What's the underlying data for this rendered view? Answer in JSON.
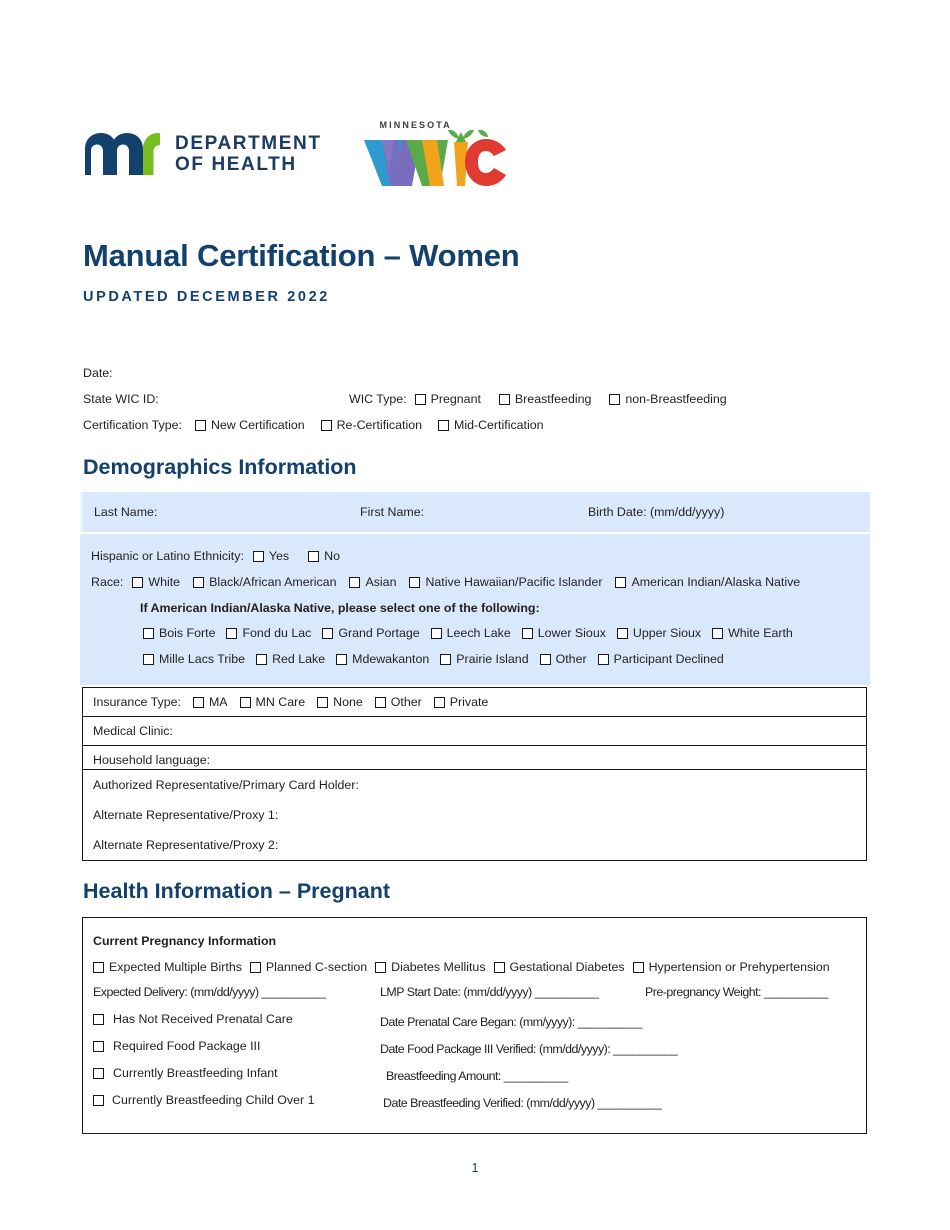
{
  "logos": {
    "mdh": {
      "mark": "mn-logo-icon",
      "line1": "DEPARTMENT",
      "line2": "OF HEALTH"
    },
    "wic": {
      "supertitle": "MINNESOTA",
      "wordmark": "WIC"
    }
  },
  "title": "Manual Certification – Women",
  "subtitle": "UPDATED DECEMBER 2022",
  "topform": {
    "date_label": "Date:",
    "state_wic_id_label": "State WIC ID:",
    "wic_type_label": "WIC Type:",
    "wic_type_options": [
      "Pregnant",
      "Breastfeeding",
      "non-Breastfeeding"
    ],
    "cert_type_label": "Certification Type:",
    "cert_type_options": [
      "New Certification",
      "Re-Certification",
      "Mid-Certification"
    ]
  },
  "demographics": {
    "heading": "Demographics Information",
    "name_row": {
      "last_name": "Last Name:",
      "first_name": "First Name:",
      "birth_date": "Birth Date: (mm/dd/yyyy)"
    },
    "ethnicity_label": "Hispanic or Latino Ethnicity:",
    "ethnicity_options": [
      "Yes",
      "No"
    ],
    "race_label": "Race:",
    "race_options": [
      "White",
      "Black/African American",
      "Asian",
      "Native Hawaiian/Pacific Islander",
      "American Indian/Alaska Native"
    ],
    "tribe_note": "If American Indian/Alaska Native, please select one of the following:",
    "tribes_row1": [
      "Bois Forte",
      "Fond du Lac",
      "Grand Portage",
      "Leech Lake",
      "Lower Sioux",
      "Upper Sioux",
      "White Earth"
    ],
    "tribes_row2": [
      "Mille Lacs Tribe",
      "Red Lake",
      "Mdewakanton",
      "Prairie Island",
      "Other",
      "Participant Declined"
    ],
    "insurance_label": "Insurance Type:",
    "insurance_options": [
      "MA",
      "MN Care",
      "None",
      "Other",
      "Private"
    ],
    "medical_clinic_label": "Medical Clinic:",
    "household_language_label": "Household language:",
    "authorized_rep_label": "Authorized Representative/Primary Card Holder:",
    "alt_rep1_label": "Alternate Representative/Proxy 1:",
    "alt_rep2_label": "Alternate Representative/Proxy 2:"
  },
  "health": {
    "heading": "Health Information – Pregnant",
    "subheading": "Current Pregnancy Information",
    "conditions": [
      "Expected Multiple Births",
      "Planned C-section",
      "Diabetes Mellitus",
      "Gestational Diabetes",
      "Hypertension or Prehypertension"
    ],
    "expected_delivery": "Expected Delivery: (mm/dd/yyyy) __________",
    "lmp_start_date": "LMP Start Date: (mm/dd/yyyy) __________",
    "prepregnancy_weight": "Pre-pregnancy Weight: __________",
    "rows": [
      {
        "check": "Has Not Received Prenatal Care",
        "detail": "Date Prenatal Care Began: (mm/yyyy): __________"
      },
      {
        "check": "Required Food Package III",
        "detail": "Date Food Package III Verified: (mm/dd/yyyy): __________"
      },
      {
        "check": "Currently Breastfeeding Infant",
        "detail": "Breastfeeding Amount: __________"
      },
      {
        "check": "Currently Breastfeeding Child Over 1",
        "detail": "Date Breastfeeding Verified: (mm/dd/yyyy) __________"
      }
    ]
  },
  "page_number": "1",
  "colors": {
    "navy": "#13416e",
    "table_blue": "#d9e9fb",
    "green": "#78be21",
    "rule": "#1a1a1a"
  }
}
